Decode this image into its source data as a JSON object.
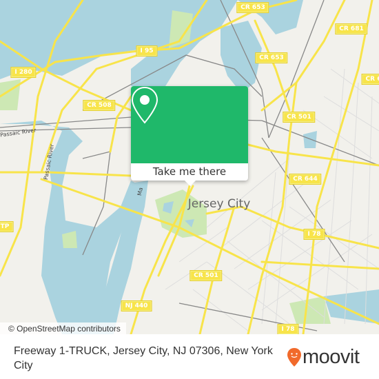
{
  "map": {
    "place_label": "Jersey City",
    "river_labels": [
      "Passaic River",
      "Passaic River",
      "Ma"
    ],
    "road_shields": [
      {
        "text": "CR 653"
      },
      {
        "text": "CR 681"
      },
      {
        "text": "I 95"
      },
      {
        "text": "I 280"
      },
      {
        "text": "CR 653"
      },
      {
        "text": "CR 6"
      },
      {
        "text": "CR 508"
      },
      {
        "text": "CR 501"
      },
      {
        "text": "CR 644"
      },
      {
        "text": "I 78"
      },
      {
        "text": "CR 501"
      },
      {
        "text": "NJ 440"
      },
      {
        "text": "I 78"
      },
      {
        "text": "TP"
      }
    ],
    "colors": {
      "water": "#aad3df",
      "land": "#f2f1ec",
      "park": "#cde8b4",
      "road": "#f8e44a",
      "accent": "#1fb86a"
    }
  },
  "popup": {
    "icon": "map-pin-icon",
    "label": "Take me there"
  },
  "attribution": "© OpenStreetMap contributors",
  "footer": {
    "address": "Freeway 1-TRUCK, Jersey City, NJ 07306, New York City",
    "logo_text": "moovit",
    "logo_color": "#f16a2b"
  }
}
